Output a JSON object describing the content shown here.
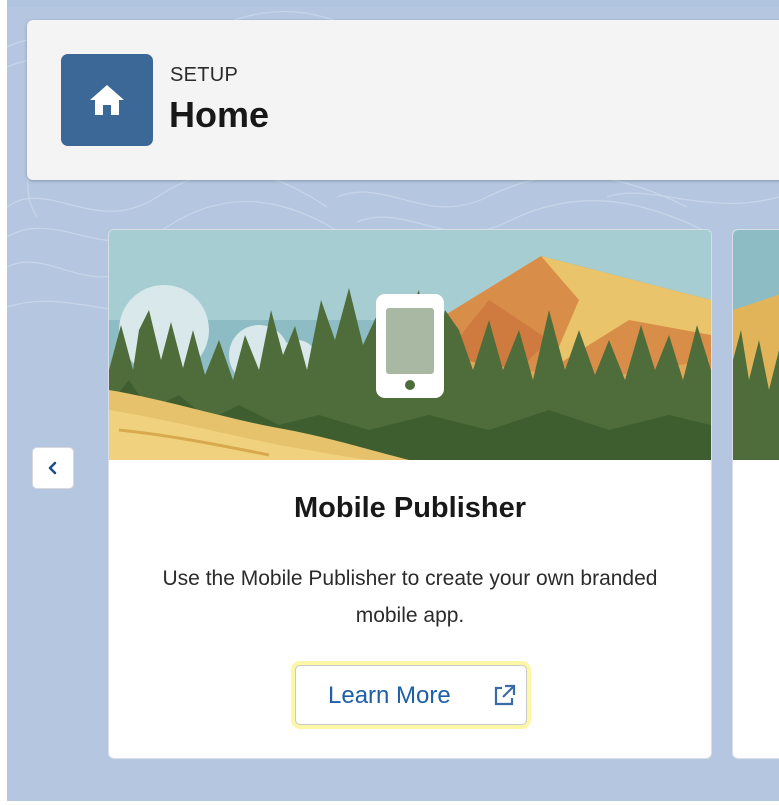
{
  "header": {
    "eyebrow": "SETUP",
    "title": "Home",
    "icon": "home-icon"
  },
  "carousel": {
    "prev_icon": "chevron-left-icon",
    "cards": [
      {
        "title": "Mobile Publisher",
        "description": "Use the Mobile Publisher to create your own branded mobile app.",
        "button_label": "Learn More",
        "button_icon": "external-link-icon"
      }
    ]
  },
  "colors": {
    "brand_tile": "#3b6897",
    "link": "#1e5fa8",
    "focus_ring": "#fbf7a6",
    "background": "#b5c7e0"
  }
}
